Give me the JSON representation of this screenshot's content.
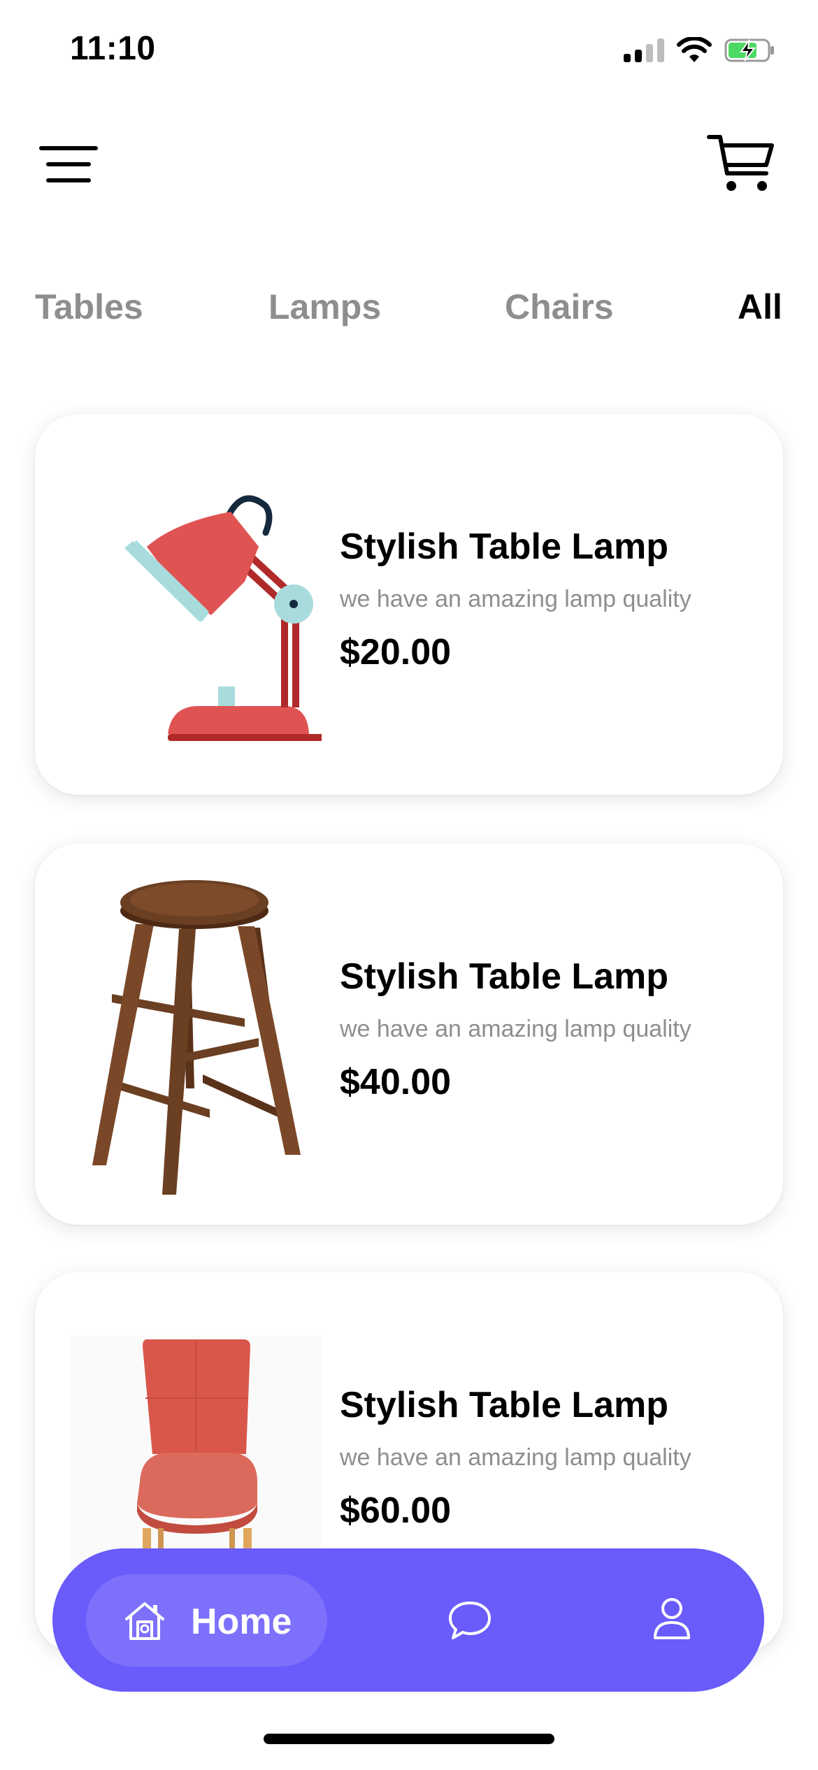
{
  "status_bar": {
    "time": "11:10"
  },
  "header": {
    "menu_icon": "hamburger-menu-icon",
    "cart_icon": "shopping-cart-icon"
  },
  "tabs": [
    {
      "label": "Tables",
      "active": false
    },
    {
      "label": "Lamps",
      "active": false
    },
    {
      "label": "Chairs",
      "active": false
    },
    {
      "label": "All",
      "active": true
    }
  ],
  "products": [
    {
      "title": "Stylish Table Lamp",
      "description": "we have an amazing lamp quality",
      "price": "$20.00",
      "image": "desk-lamp"
    },
    {
      "title": "Stylish Table Lamp",
      "description": "we have an amazing lamp quality",
      "price": "$40.00",
      "image": "wooden-stool"
    },
    {
      "title": "Stylish Table Lamp",
      "description": "we have an amazing lamp quality",
      "price": "$60.00",
      "image": "red-chair"
    }
  ],
  "bottom_nav": {
    "home_label": "Home",
    "home_icon": "home-icon",
    "chat_icon": "chat-bubble-icon",
    "profile_icon": "user-profile-icon"
  },
  "colors": {
    "accent": "#6a5bfb",
    "muted_text": "#8e8e8e",
    "lamp_red": "#e05353",
    "lamp_teal": "#a8dcdc",
    "wood": "#6b3f22",
    "chair_red": "#dc5a4c",
    "battery_green": "#4cd964"
  }
}
